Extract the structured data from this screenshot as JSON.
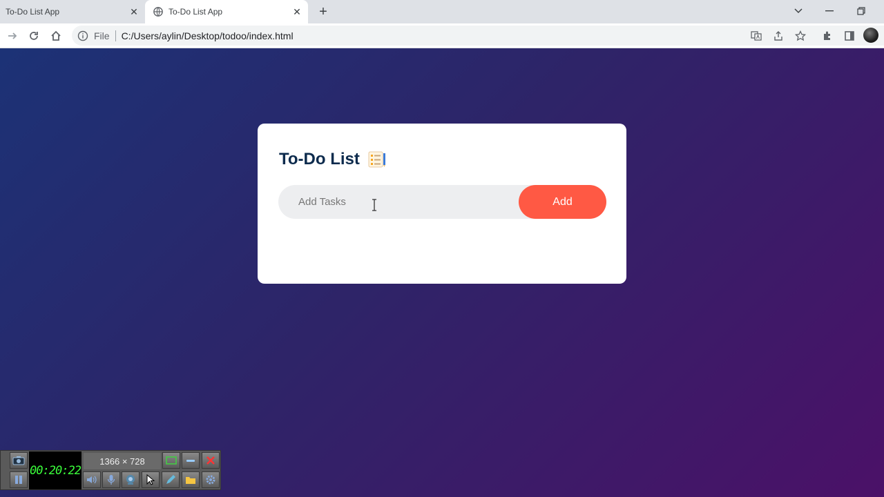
{
  "browser": {
    "tabs": [
      {
        "title": "To-Do List App",
        "active": false
      },
      {
        "title": "To-Do List App",
        "active": true
      }
    ],
    "address": {
      "scheme_label": "File",
      "url": "C:/Users/aylin/Desktop/todoo/index.html"
    }
  },
  "app": {
    "title": "To-Do List",
    "input_placeholder": "Add Tasks",
    "add_button_label": "Add"
  },
  "recorder": {
    "timer": "00:20:22",
    "dimensions": "1366 × 728"
  },
  "colors": {
    "add_button": "#ff5944",
    "title": "#0d2b4d",
    "background_start": "#1c3276",
    "background_end": "#4b1168"
  }
}
